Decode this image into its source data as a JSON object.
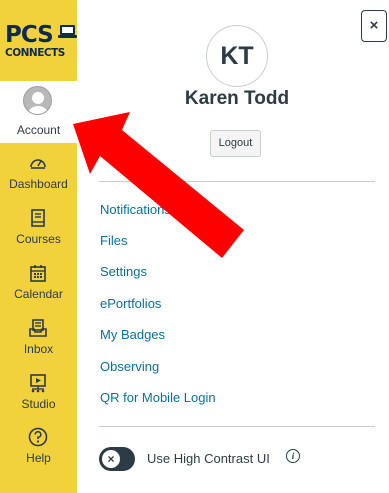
{
  "logo": {
    "line1": "PCS",
    "line2": "CONNECTS"
  },
  "nav": {
    "account": "Account",
    "items": [
      {
        "label": "Dashboard",
        "icon": "dashboard-icon"
      },
      {
        "label": "Courses",
        "icon": "courses-icon"
      },
      {
        "label": "Calendar",
        "icon": "calendar-icon"
      },
      {
        "label": "Inbox",
        "icon": "inbox-icon"
      },
      {
        "label": "Studio",
        "icon": "studio-icon"
      },
      {
        "label": "Help",
        "icon": "help-icon"
      }
    ]
  },
  "close_label": "×",
  "profile": {
    "initials": "KT",
    "name": "Karen Todd",
    "logout_label": "Logout"
  },
  "links": [
    "Notifications",
    "Files",
    "Settings",
    "ePortfolios",
    "My Badges",
    "Observing",
    "QR for Mobile Login"
  ],
  "contrast": {
    "label": "Use High Contrast UI",
    "toggle_glyph": "×",
    "info_glyph": "i",
    "enabled": false
  },
  "colors": {
    "sidebar": "#F2D23C",
    "link": "#0770A3",
    "text": "#2d3b45",
    "arrow": "#FF0000"
  }
}
